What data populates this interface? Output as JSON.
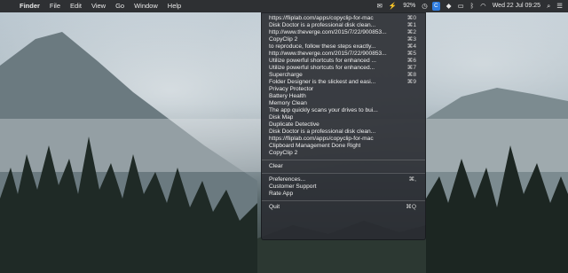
{
  "menubar": {
    "apple_icon": "apple-icon",
    "items": [
      "Finder",
      "File",
      "Edit",
      "View",
      "Go",
      "Window",
      "Help"
    ],
    "status": {
      "mail_icon": "mail-icon",
      "battery_percent": "92%",
      "copyclip_icon_glyph": "C",
      "datetime": "Wed 22 Jul  09:25"
    }
  },
  "dropdown": {
    "clips": [
      {
        "label": "https://fliplab.com/apps/copyclip-for-mac",
        "shortcut": "⌘0"
      },
      {
        "label": "Disk Doctor is a professional disk clean...",
        "shortcut": "⌘1"
      },
      {
        "label": "http://www.theverge.com/2015/7/22/900853...",
        "shortcut": "⌘2"
      },
      {
        "label": "CopyClip 2",
        "shortcut": "⌘3"
      },
      {
        "label": "to reproduce, follow these steps exactly...",
        "shortcut": "⌘4"
      },
      {
        "label": "http://www.theverge.com/2015/7/22/900853...",
        "shortcut": "⌘5"
      },
      {
        "label": "Utilize powerful shortcuts for enhanced ...",
        "shortcut": "⌘6"
      },
      {
        "label": "Utilize powerful shortcuts for enhanced...",
        "shortcut": "⌘7"
      },
      {
        "label": "Supercharge",
        "shortcut": "⌘8"
      },
      {
        "label": "Folder Designer is the slickest and easi...",
        "shortcut": "⌘9"
      },
      {
        "label": "Privacy Protector",
        "shortcut": ""
      },
      {
        "label": "Battery Health",
        "shortcut": ""
      },
      {
        "label": "Memory Clean",
        "shortcut": ""
      },
      {
        "label": "The app quickly scans your drives to bui...",
        "shortcut": ""
      },
      {
        "label": "Disk Map",
        "shortcut": ""
      },
      {
        "label": "Duplicate Detective",
        "shortcut": ""
      },
      {
        "label": "Disk Doctor is a professional disk clean...",
        "shortcut": ""
      },
      {
        "label": "https://fliplab.com/apps/copyclip-for-mac",
        "shortcut": ""
      },
      {
        "label": "Clipboard Management Done Right",
        "shortcut": ""
      },
      {
        "label": "CopyClip 2",
        "shortcut": ""
      }
    ],
    "clear_label": "Clear",
    "preferences": {
      "label": "Preferences...",
      "shortcut": "⌘,"
    },
    "support_label": "Customer Support",
    "rate_label": "Rate App",
    "quit": {
      "label": "Quit",
      "shortcut": "⌘Q"
    }
  }
}
